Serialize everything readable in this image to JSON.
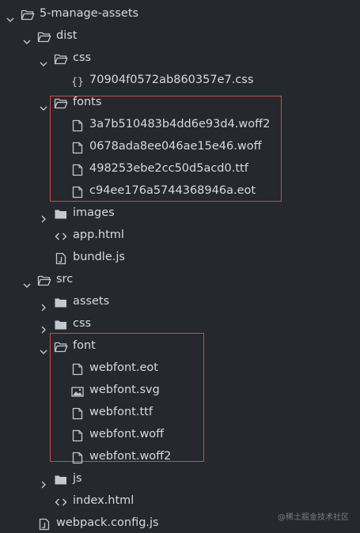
{
  "tree": {
    "items": [
      {
        "label": "5-manage-assets",
        "kind": "folder",
        "expanded": true,
        "depth": 0,
        "icon": "folder-open-icon"
      },
      {
        "label": "dist",
        "kind": "folder",
        "expanded": true,
        "depth": 1,
        "icon": "folder-open-icon"
      },
      {
        "label": "css",
        "kind": "folder",
        "expanded": true,
        "depth": 2,
        "icon": "folder-open-icon"
      },
      {
        "label": "70904f0572ab860357e7.css",
        "kind": "file",
        "depth": 3,
        "icon": "braces-icon"
      },
      {
        "label": "fonts",
        "kind": "folder",
        "expanded": true,
        "depth": 2,
        "icon": "folder-open-icon"
      },
      {
        "label": "3a7b510483b4dd6e93d4.woff2",
        "kind": "file",
        "depth": 3,
        "icon": "file-icon"
      },
      {
        "label": "0678ada8ee046ae15e46.woff",
        "kind": "file",
        "depth": 3,
        "icon": "file-icon"
      },
      {
        "label": "498253ebe2cc50d5acd0.ttf",
        "kind": "file",
        "depth": 3,
        "icon": "file-icon"
      },
      {
        "label": "c94ee176a5744368946a.eot",
        "kind": "file",
        "depth": 3,
        "icon": "file-icon"
      },
      {
        "label": "images",
        "kind": "folder",
        "expanded": false,
        "depth": 2,
        "icon": "folder-icon"
      },
      {
        "label": "app.html",
        "kind": "file",
        "depth": 2,
        "icon": "code-icon"
      },
      {
        "label": "bundle.js",
        "kind": "file",
        "depth": 2,
        "icon": "js-file-icon"
      },
      {
        "label": "src",
        "kind": "folder",
        "expanded": true,
        "depth": 1,
        "icon": "folder-open-icon"
      },
      {
        "label": "assets",
        "kind": "folder",
        "expanded": false,
        "depth": 2,
        "icon": "folder-icon"
      },
      {
        "label": "css",
        "kind": "folder",
        "expanded": false,
        "depth": 2,
        "icon": "folder-icon"
      },
      {
        "label": "font",
        "kind": "folder",
        "expanded": true,
        "depth": 2,
        "icon": "folder-open-icon"
      },
      {
        "label": "webfont.eot",
        "kind": "file",
        "depth": 3,
        "icon": "file-icon"
      },
      {
        "label": "webfont.svg",
        "kind": "file",
        "depth": 3,
        "icon": "image-icon"
      },
      {
        "label": "webfont.ttf",
        "kind": "file",
        "depth": 3,
        "icon": "file-icon"
      },
      {
        "label": "webfont.woff",
        "kind": "file",
        "depth": 3,
        "icon": "file-icon"
      },
      {
        "label": "webfont.woff2",
        "kind": "file",
        "depth": 3,
        "icon": "file-icon"
      },
      {
        "label": "js",
        "kind": "folder",
        "expanded": false,
        "depth": 2,
        "icon": "folder-icon"
      },
      {
        "label": "index.html",
        "kind": "file",
        "depth": 2,
        "icon": "code-icon"
      },
      {
        "label": "webpack.config.js",
        "kind": "file",
        "depth": 1,
        "icon": "js-file-icon"
      }
    ]
  },
  "watermark": "@稀土掘金技术社区",
  "colors": {
    "background": "#25282c",
    "text": "#d7dae0",
    "icon": "#c5c8ce",
    "highlight_border": "#d44a4a"
  }
}
